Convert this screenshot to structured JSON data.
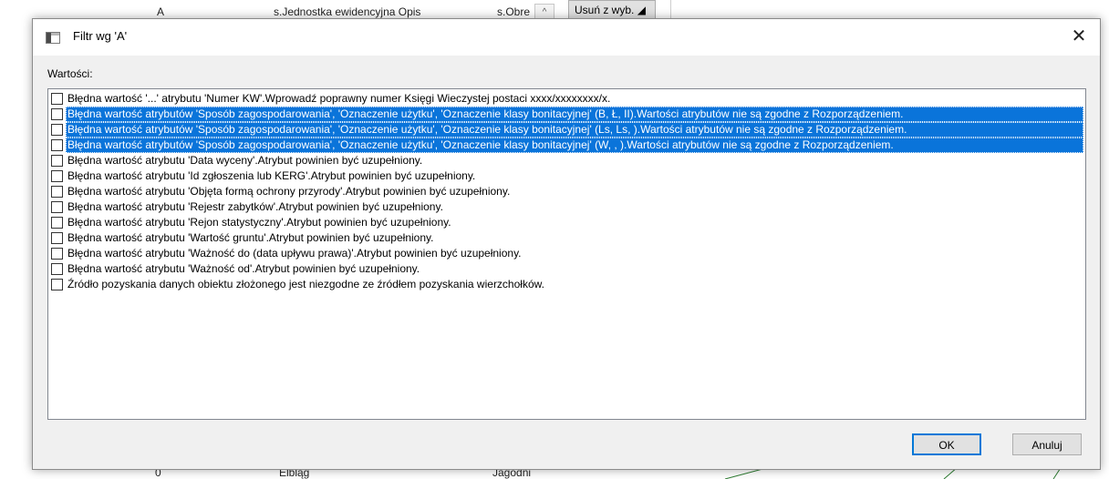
{
  "background": {
    "table_cells": [
      "A",
      "s.Jednostka ewidencyjna Opis",
      "s.Obre"
    ],
    "remove_button_label": "Usuń z wyb.",
    "bottom_cells": [
      "0",
      "Elbląg",
      "Jagodni"
    ]
  },
  "dialog": {
    "title": "Filtr wg 'A'",
    "values_label": "Wartości:",
    "items": [
      {
        "text": "Błędna wartość '...' atrybutu 'Numer KW'.Wprowadź poprawny numer Księgi Wieczystej postaci xxxx/xxxxxxxx/x.",
        "selected": false,
        "checked": false
      },
      {
        "text": "Błędna wartość atrybutów 'Sposób zagospodarowania', 'Oznaczenie użytku', 'Oznaczenie klasy bonitacyjnej' (B, Ł, II).Wartości atrybutów nie są zgodne z Rozporządzeniem.",
        "selected": true,
        "checked": false
      },
      {
        "text": "Błędna wartość atrybutów 'Sposób zagospodarowania', 'Oznaczenie użytku', 'Oznaczenie klasy bonitacyjnej' (Ls, Ls, ).Wartości atrybutów nie są zgodne z Rozporządzeniem.",
        "selected": true,
        "checked": false
      },
      {
        "text": "Błędna wartość atrybutów 'Sposób zagospodarowania', 'Oznaczenie użytku', 'Oznaczenie klasy bonitacyjnej' (W, , ).Wartości atrybutów nie są zgodne z Rozporządzeniem.",
        "selected": true,
        "checked": false
      },
      {
        "text": "Błędna wartość atrybutu 'Data wyceny'.Atrybut powinien być uzupełniony.",
        "selected": false,
        "checked": false
      },
      {
        "text": "Błędna wartość atrybutu 'Id zgłoszenia lub KERG'.Atrybut powinien być uzupełniony.",
        "selected": false,
        "checked": false
      },
      {
        "text": "Błędna wartość atrybutu 'Objęta formą ochrony przyrody'.Atrybut powinien być uzupełniony.",
        "selected": false,
        "checked": false
      },
      {
        "text": "Błędna wartość atrybutu 'Rejestr zabytków'.Atrybut powinien być uzupełniony.",
        "selected": false,
        "checked": false
      },
      {
        "text": "Błędna wartość atrybutu 'Rejon statystyczny'.Atrybut powinien być uzupełniony.",
        "selected": false,
        "checked": false
      },
      {
        "text": "Błędna wartość atrybutu 'Wartość gruntu'.Atrybut powinien być uzupełniony.",
        "selected": false,
        "checked": false
      },
      {
        "text": "Błędna wartość atrybutu 'Ważność do (data upływu prawa)'.Atrybut powinien być uzupełniony.",
        "selected": false,
        "checked": false
      },
      {
        "text": "Błędna wartość atrybutu 'Ważność od'.Atrybut powinien być uzupełniony.",
        "selected": false,
        "checked": false
      },
      {
        "text": "Źródło pozyskania danych obiektu złożonego jest niezgodne ze źródłem pozyskania wierzchołków.",
        "selected": false,
        "checked": false
      }
    ],
    "ok_label": "OK",
    "cancel_label": "Anuluj",
    "close_glyph": "✕"
  },
  "colors": {
    "selection": "#0a74da",
    "dialog_bg": "#f0f0f0",
    "default_button_border": "#0078d7"
  }
}
